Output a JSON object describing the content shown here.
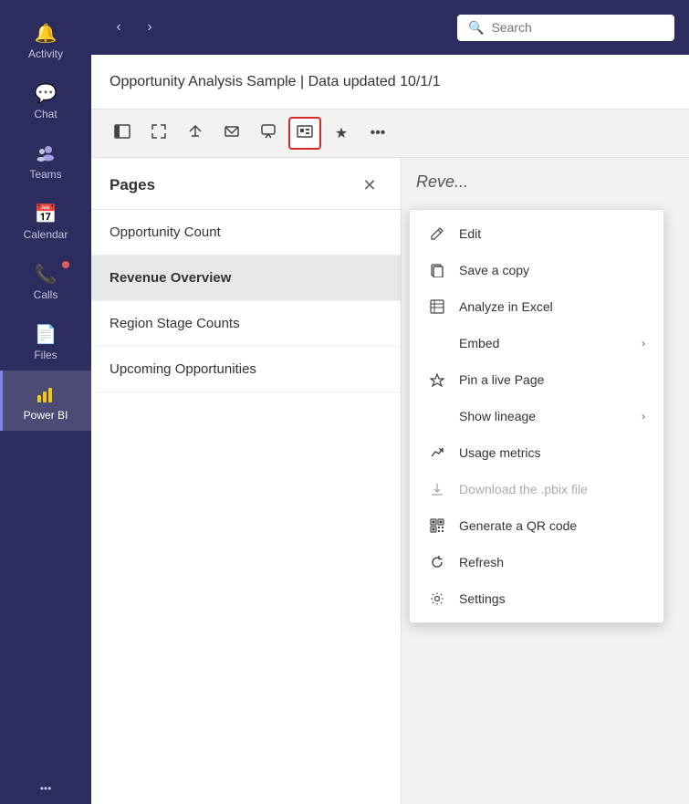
{
  "sidebar": {
    "items": [
      {
        "label": "Activity",
        "icon": "🔔",
        "active": false
      },
      {
        "label": "Chat",
        "icon": "💬",
        "active": false
      },
      {
        "label": "Teams",
        "icon": "👥",
        "active": false
      },
      {
        "label": "Calendar",
        "icon": "📅",
        "active": false
      },
      {
        "label": "Calls",
        "icon": "📞",
        "active": false,
        "notification": true
      },
      {
        "label": "Files",
        "icon": "📄",
        "active": false
      },
      {
        "label": "Power BI",
        "icon": "📊",
        "active": true
      }
    ],
    "more_label": "...",
    "more_icon": "•••"
  },
  "topbar": {
    "back_arrow": "‹",
    "forward_arrow": "›",
    "search_placeholder": "Search"
  },
  "content_header": {
    "title": "Opportunity Analysis Sample | Data updated 10/1/1"
  },
  "toolbar": {
    "icons": [
      {
        "name": "pages-icon",
        "symbol": "☰",
        "active": false
      },
      {
        "name": "fit-icon",
        "symbol": "⇥",
        "active": false
      },
      {
        "name": "share-icon",
        "symbol": "↗",
        "active": false
      },
      {
        "name": "email-icon",
        "symbol": "✉",
        "active": false
      },
      {
        "name": "chat-icon",
        "symbol": "💬",
        "active": false
      },
      {
        "name": "embed-icon",
        "symbol": "⊞",
        "active": true
      },
      {
        "name": "bookmark-icon",
        "symbol": "★",
        "active": false
      },
      {
        "name": "more-icon",
        "symbol": "•••",
        "active": false
      }
    ]
  },
  "pages_panel": {
    "title": "Pages",
    "items": [
      {
        "label": "Opportunity Count",
        "selected": false
      },
      {
        "label": "Revenue Overview",
        "selected": true
      },
      {
        "label": "Region Stage Counts",
        "selected": false
      },
      {
        "label": "Upcoming Opportunities",
        "selected": false
      }
    ]
  },
  "report_area": {
    "label": "Reve..."
  },
  "dropdown_menu": {
    "items": [
      {
        "icon": "✏️",
        "label": "Edit",
        "disabled": false,
        "has_chevron": false
      },
      {
        "icon": "⧉",
        "label": "Save a copy",
        "disabled": false,
        "has_chevron": false
      },
      {
        "icon": "⊞",
        "label": "Analyze in Excel",
        "disabled": false,
        "has_chevron": false
      },
      {
        "icon": "",
        "label": "Embed",
        "disabled": false,
        "has_chevron": true
      },
      {
        "icon": "↗",
        "label": "Pin a live Page",
        "disabled": false,
        "has_chevron": false
      },
      {
        "icon": "",
        "label": "Show lineage",
        "disabled": false,
        "has_chevron": true
      },
      {
        "icon": "↗",
        "label": "Usage metrics",
        "disabled": false,
        "has_chevron": false
      },
      {
        "icon": "⬇",
        "label": "Download the .pbix file",
        "disabled": true,
        "has_chevron": false
      },
      {
        "icon": "⊞",
        "label": "Generate a QR code",
        "disabled": false,
        "has_chevron": false
      },
      {
        "icon": "↺",
        "label": "Refresh",
        "disabled": false,
        "has_chevron": false
      },
      {
        "icon": "⚙",
        "label": "Settings",
        "disabled": false,
        "has_chevron": false
      }
    ]
  }
}
